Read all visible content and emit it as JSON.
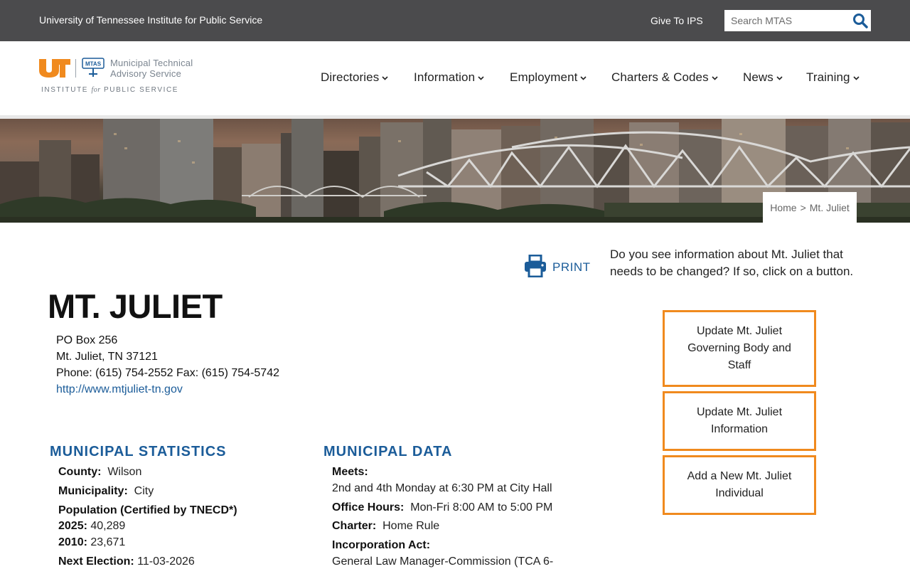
{
  "topbar": {
    "org_name": "University of Tennessee Institute for Public Service",
    "give_link": "Give To IPS",
    "search_placeholder": "Search MTAS"
  },
  "logo": {
    "mtas_line1": "Municipal Technical",
    "mtas_line2": "Advisory Service",
    "seal_text": "MTAS",
    "ips_pre": "INSTITUTE",
    "ips_for": "for",
    "ips_post": "PUBLIC SERVICE"
  },
  "nav": {
    "items": [
      {
        "label": "Directories"
      },
      {
        "label": "Information"
      },
      {
        "label": "Employment"
      },
      {
        "label": "Charters & Codes"
      },
      {
        "label": "News"
      },
      {
        "label": "Training"
      }
    ]
  },
  "breadcrumb": {
    "home": "Home",
    "separator": ">",
    "current": "Mt. Juliet"
  },
  "print_label": "PRINT",
  "page_title": "MT. JULIET",
  "address": {
    "line1": "PO Box 256",
    "line2": "Mt. Juliet, TN 37121",
    "phone": "Phone: (615) 754-2552 Fax: (615) 754-5742",
    "website": "http://www.mtjuliet-tn.gov"
  },
  "statistics": {
    "heading": "MUNICIPAL STATISTICS",
    "county_label": "County:",
    "county_value": "Wilson",
    "municipality_label": "Municipality:",
    "municipality_value": "City",
    "population_label": "Population (Certified by TNECD*)",
    "pop_2025_label": "2025:",
    "pop_2025_value": "40,289",
    "pop_2010_label": "2010:",
    "pop_2010_value": "23,671",
    "election_label": "Next Election:",
    "election_value": "11-03-2026"
  },
  "municipal_data": {
    "heading": "MUNICIPAL DATA",
    "meets_label": "Meets:",
    "meets_value": "2nd and 4th Monday at 6:30 PM at City Hall",
    "hours_label": "Office Hours:",
    "hours_value": "Mon-Fri 8:00 AM to 5:00 PM",
    "charter_label": "Charter:",
    "charter_value": "Home Rule",
    "incorporation_label": "Incorporation Act:",
    "incorporation_value": "General Law Manager-Commission (TCA 6-"
  },
  "sidebar": {
    "notice": "Do you see information about Mt. Juliet that needs to be changed? If so, click on a button.",
    "buttons": [
      {
        "label": "Update Mt. Juliet Governing Body and Staff"
      },
      {
        "label": "Update Mt. Juliet Information"
      },
      {
        "label": "Add a New Mt. Juliet Individual"
      }
    ]
  },
  "colors": {
    "topbar_bg": "#4b4b4d",
    "link_blue": "#1b5c99",
    "accent_orange": "#f08a1e",
    "ut_orange": "#f08a1e"
  }
}
